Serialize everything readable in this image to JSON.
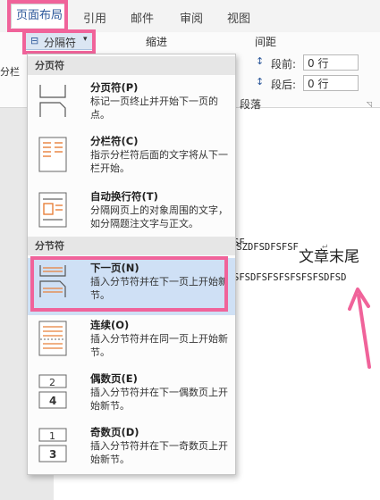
{
  "tabs": [
    "页面布局",
    "引用",
    "邮件",
    "审阅",
    "视图"
  ],
  "ribbon": {
    "left_partial_1": "分栏",
    "breaks_button": "分隔符",
    "indent_label": "缩进",
    "spacing_label": "间距",
    "before_label": "段前:",
    "before_value": "0 行",
    "after_label": "段后:",
    "after_value": "0 行",
    "paragraph_group": "段落"
  },
  "menu": {
    "page_breaks_header": "分页符",
    "section_breaks_header": "分节符",
    "items": [
      {
        "title": "分页符(P)",
        "desc": "标记一页终止并开始下一页的点。"
      },
      {
        "title": "分栏符(C)",
        "desc": "指示分栏符后面的文字将从下一栏开始。"
      },
      {
        "title": "自动换行符(T)",
        "desc": "分隔网页上的对象周围的文字，如分隔题注文字与正文。"
      },
      {
        "title": "下一页(N)",
        "desc": "插入分节符并在下一页上开始新节。"
      },
      {
        "title": "连续(O)",
        "desc": "插入分节符并在同一页上开始新节。"
      },
      {
        "title": "偶数页(E)",
        "desc": "插入分节符并在下一偶数页上开始新节。"
      },
      {
        "title": "奇数页(D)",
        "desc": "插入分节符并在下一奇数页上开始新节。"
      }
    ]
  },
  "document": {
    "line1": "FSZDFSDFSFSF",
    "line2": "SF",
    "line3": "SFSDFSFSFSFSFSFSDFSD",
    "annotation": "文章末尾"
  },
  "colors": {
    "highlight_box": "#f0639a",
    "selected_item": "#cfe0f5"
  }
}
